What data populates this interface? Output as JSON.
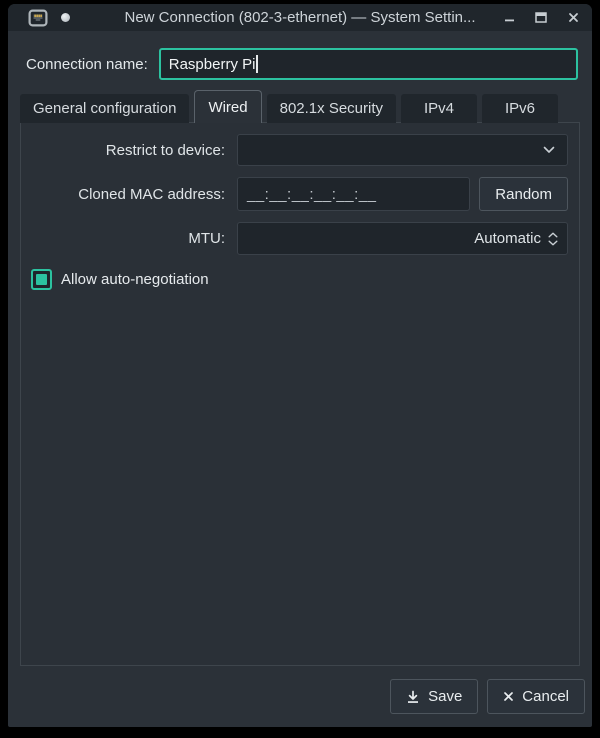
{
  "window": {
    "title": "New Connection (802-3-ethernet) — System Settin...",
    "icons": {
      "app": "ethernet-port-icon",
      "modified": "unsaved-indicator-dot",
      "minimize": "minimize-icon",
      "maximize": "maximize-icon",
      "close": "close-icon"
    }
  },
  "header": {
    "connection_name_label": "Connection name:",
    "connection_name_value": "Raspberry Pi"
  },
  "tabs": {
    "items": [
      {
        "label": "General configuration",
        "active": false
      },
      {
        "label": "Wired",
        "active": true
      },
      {
        "label": "802.1x Security",
        "active": false
      },
      {
        "label": "IPv4",
        "active": false
      },
      {
        "label": "IPv6",
        "active": false
      }
    ]
  },
  "wired_form": {
    "restrict_to_device": {
      "label": "Restrict to device:",
      "value": ""
    },
    "cloned_mac": {
      "label": "Cloned MAC address:",
      "placeholder": "__:__:__:__:__:__",
      "random_button": "Random"
    },
    "mtu": {
      "label": "MTU:",
      "value": "Automatic"
    },
    "auto_negotiation": {
      "label": "Allow auto-negotiation",
      "checked": true
    }
  },
  "footer": {
    "save_label": "Save",
    "cancel_label": "Cancel"
  },
  "colors": {
    "accent": "#2cc2a0",
    "titlebar_bg": "#20262c",
    "window_bg": "#2b3138",
    "input_bg": "#1f252b",
    "border": "#3a4149"
  }
}
